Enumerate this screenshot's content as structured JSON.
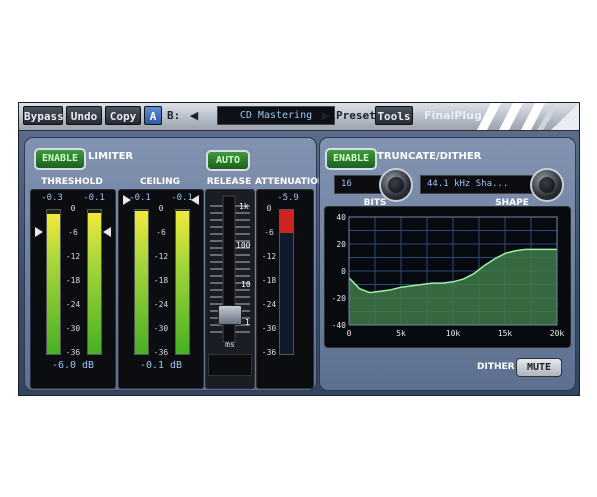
{
  "toolbar": {
    "bypass": "Bypass",
    "undo": "Undo",
    "copy": "Copy",
    "ab_a": "A",
    "ab_b": "B:",
    "preset_name": "CD Mastering",
    "preset": "Preset",
    "tools": "Tools",
    "brand": "FinalPlug",
    "prev_arrow": "◀",
    "next_arrow": "▶"
  },
  "limiter": {
    "enable_label": "ENABLE",
    "title": "LIMITER",
    "threshold": {
      "label": "THRESHOLD",
      "left_value": "-0.3",
      "right_value": "-0.1",
      "readout": "-6.0 dB",
      "left_level": 0.97,
      "right_level": 0.98,
      "setting_db": -6.0
    },
    "ceiling": {
      "label": "CEILING",
      "left_value": "-0.1",
      "right_value": "-0.1",
      "readout": "-0.1 dB",
      "left_level": 0.99,
      "right_level": 0.99,
      "setting_db": -0.1
    },
    "scale_ticks": [
      "0",
      "-6",
      "-12",
      "-18",
      "-24",
      "-30",
      "-36"
    ],
    "release": {
      "label": "RELEASE",
      "auto_label": "AUTO",
      "unit": "ms",
      "scale": [
        "1k",
        "100",
        "10",
        "1"
      ],
      "fader_value": 0.15
    },
    "attenuation": {
      "label": "ATTENUATION",
      "value": "-5.9",
      "level": 0.16
    }
  },
  "dither": {
    "enable_label": "ENABLE",
    "title": "TRUNCATE/DITHER",
    "bits_value": "16",
    "bits_label": "BITS",
    "shape_value": "44.1 kHz Sha...",
    "shape_label": "SHAPE",
    "dither_label": "DITHER",
    "mute_label": "MUTE",
    "chart_data": {
      "type": "area",
      "x": [
        0,
        1000,
        2000,
        3000,
        4000,
        5000,
        6000,
        7000,
        8000,
        9000,
        10000,
        11000,
        12000,
        13000,
        14000,
        15000,
        16000,
        17000,
        18000,
        19000,
        20000
      ],
      "values": [
        -5,
        -13,
        -16,
        -15,
        -14,
        -12,
        -11,
        -10,
        -9,
        -9,
        -8,
        -6,
        -2,
        4,
        9,
        13,
        15,
        16,
        16,
        16,
        16
      ],
      "x_ticks": [
        "0",
        "5k",
        "10k",
        "15k",
        "20k"
      ],
      "y_ticks": [
        "40",
        "20",
        "0",
        "-20",
        "-40"
      ],
      "xlim": [
        0,
        20000
      ],
      "ylim": [
        -40,
        40
      ],
      "grid": true
    }
  },
  "colors": {
    "panel": "#6b7e9d",
    "meter_fill": "#8fc93a",
    "graph_fill": "#3f7a4a",
    "graph_line": "#9ef0a4",
    "readout": "#9fc4f0"
  }
}
